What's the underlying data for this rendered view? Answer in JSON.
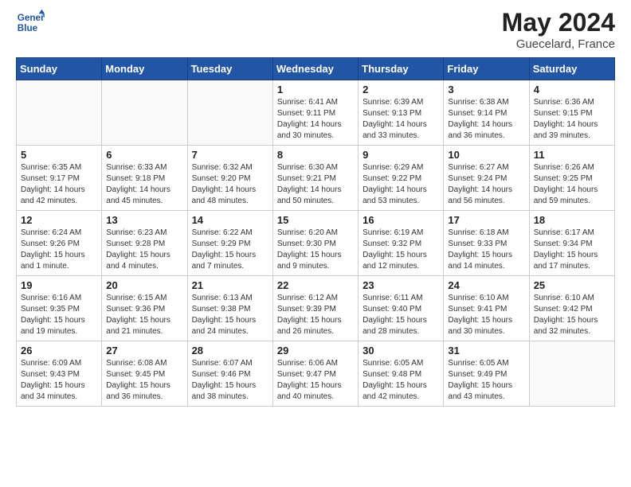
{
  "header": {
    "logo_general": "General",
    "logo_blue": "Blue",
    "month_year": "May 2024",
    "location": "Guecelard, France"
  },
  "weekdays": [
    "Sunday",
    "Monday",
    "Tuesday",
    "Wednesday",
    "Thursday",
    "Friday",
    "Saturday"
  ],
  "weeks": [
    [
      {
        "day": "",
        "info": ""
      },
      {
        "day": "",
        "info": ""
      },
      {
        "day": "",
        "info": ""
      },
      {
        "day": "1",
        "info": "Sunrise: 6:41 AM\nSunset: 9:11 PM\nDaylight: 14 hours and 30 minutes."
      },
      {
        "day": "2",
        "info": "Sunrise: 6:39 AM\nSunset: 9:13 PM\nDaylight: 14 hours and 33 minutes."
      },
      {
        "day": "3",
        "info": "Sunrise: 6:38 AM\nSunset: 9:14 PM\nDaylight: 14 hours and 36 minutes."
      },
      {
        "day": "4",
        "info": "Sunrise: 6:36 AM\nSunset: 9:15 PM\nDaylight: 14 hours and 39 minutes."
      }
    ],
    [
      {
        "day": "5",
        "info": "Sunrise: 6:35 AM\nSunset: 9:17 PM\nDaylight: 14 hours and 42 minutes."
      },
      {
        "day": "6",
        "info": "Sunrise: 6:33 AM\nSunset: 9:18 PM\nDaylight: 14 hours and 45 minutes."
      },
      {
        "day": "7",
        "info": "Sunrise: 6:32 AM\nSunset: 9:20 PM\nDaylight: 14 hours and 48 minutes."
      },
      {
        "day": "8",
        "info": "Sunrise: 6:30 AM\nSunset: 9:21 PM\nDaylight: 14 hours and 50 minutes."
      },
      {
        "day": "9",
        "info": "Sunrise: 6:29 AM\nSunset: 9:22 PM\nDaylight: 14 hours and 53 minutes."
      },
      {
        "day": "10",
        "info": "Sunrise: 6:27 AM\nSunset: 9:24 PM\nDaylight: 14 hours and 56 minutes."
      },
      {
        "day": "11",
        "info": "Sunrise: 6:26 AM\nSunset: 9:25 PM\nDaylight: 14 hours and 59 minutes."
      }
    ],
    [
      {
        "day": "12",
        "info": "Sunrise: 6:24 AM\nSunset: 9:26 PM\nDaylight: 15 hours and 1 minute."
      },
      {
        "day": "13",
        "info": "Sunrise: 6:23 AM\nSunset: 9:28 PM\nDaylight: 15 hours and 4 minutes."
      },
      {
        "day": "14",
        "info": "Sunrise: 6:22 AM\nSunset: 9:29 PM\nDaylight: 15 hours and 7 minutes."
      },
      {
        "day": "15",
        "info": "Sunrise: 6:20 AM\nSunset: 9:30 PM\nDaylight: 15 hours and 9 minutes."
      },
      {
        "day": "16",
        "info": "Sunrise: 6:19 AM\nSunset: 9:32 PM\nDaylight: 15 hours and 12 minutes."
      },
      {
        "day": "17",
        "info": "Sunrise: 6:18 AM\nSunset: 9:33 PM\nDaylight: 15 hours and 14 minutes."
      },
      {
        "day": "18",
        "info": "Sunrise: 6:17 AM\nSunset: 9:34 PM\nDaylight: 15 hours and 17 minutes."
      }
    ],
    [
      {
        "day": "19",
        "info": "Sunrise: 6:16 AM\nSunset: 9:35 PM\nDaylight: 15 hours and 19 minutes."
      },
      {
        "day": "20",
        "info": "Sunrise: 6:15 AM\nSunset: 9:36 PM\nDaylight: 15 hours and 21 minutes."
      },
      {
        "day": "21",
        "info": "Sunrise: 6:13 AM\nSunset: 9:38 PM\nDaylight: 15 hours and 24 minutes."
      },
      {
        "day": "22",
        "info": "Sunrise: 6:12 AM\nSunset: 9:39 PM\nDaylight: 15 hours and 26 minutes."
      },
      {
        "day": "23",
        "info": "Sunrise: 6:11 AM\nSunset: 9:40 PM\nDaylight: 15 hours and 28 minutes."
      },
      {
        "day": "24",
        "info": "Sunrise: 6:10 AM\nSunset: 9:41 PM\nDaylight: 15 hours and 30 minutes."
      },
      {
        "day": "25",
        "info": "Sunrise: 6:10 AM\nSunset: 9:42 PM\nDaylight: 15 hours and 32 minutes."
      }
    ],
    [
      {
        "day": "26",
        "info": "Sunrise: 6:09 AM\nSunset: 9:43 PM\nDaylight: 15 hours and 34 minutes."
      },
      {
        "day": "27",
        "info": "Sunrise: 6:08 AM\nSunset: 9:45 PM\nDaylight: 15 hours and 36 minutes."
      },
      {
        "day": "28",
        "info": "Sunrise: 6:07 AM\nSunset: 9:46 PM\nDaylight: 15 hours and 38 minutes."
      },
      {
        "day": "29",
        "info": "Sunrise: 6:06 AM\nSunset: 9:47 PM\nDaylight: 15 hours and 40 minutes."
      },
      {
        "day": "30",
        "info": "Sunrise: 6:05 AM\nSunset: 9:48 PM\nDaylight: 15 hours and 42 minutes."
      },
      {
        "day": "31",
        "info": "Sunrise: 6:05 AM\nSunset: 9:49 PM\nDaylight: 15 hours and 43 minutes."
      },
      {
        "day": "",
        "info": ""
      }
    ]
  ]
}
